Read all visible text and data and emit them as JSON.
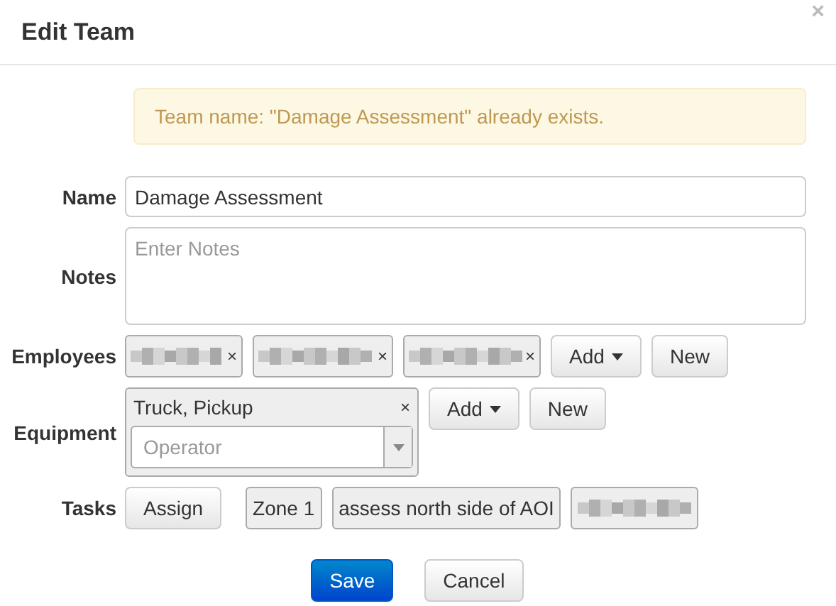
{
  "window": {
    "title": "Edit Team",
    "close": "×"
  },
  "alert": "Team name: \"Damage Assessment\" already exists.",
  "name": {
    "label": "Name",
    "value": "Damage Assessment"
  },
  "notes": {
    "label": "Notes",
    "placeholder": "Enter Notes"
  },
  "employees": {
    "label": "Employees",
    "chips": [
      {
        "kind": "redacted",
        "remove": "×"
      },
      {
        "kind": "redacted",
        "remove": "×"
      },
      {
        "kind": "redacted",
        "remove": "×"
      }
    ],
    "add": "Add",
    "new": "New"
  },
  "equipment": {
    "label": "Equipment",
    "items": [
      {
        "name": "Truck, Pickup",
        "remove": "×",
        "operator_placeholder": "Operator"
      }
    ],
    "add": "Add",
    "new": "New"
  },
  "tasks": {
    "label": "Tasks",
    "assign": "Assign",
    "chips": [
      {
        "kind": "text",
        "text": "Zone 1"
      },
      {
        "kind": "text",
        "text": "assess north side of AOI"
      },
      {
        "kind": "redacted"
      }
    ]
  },
  "buttons": [
    {
      "kind": "primary",
      "label": "Save"
    },
    {
      "kind": "default",
      "label": "Cancel"
    }
  ]
}
